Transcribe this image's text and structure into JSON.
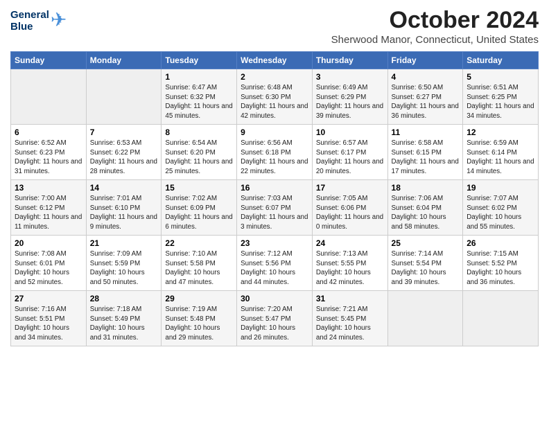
{
  "logo": {
    "line1": "General",
    "line2": "Blue"
  },
  "title": "October 2024",
  "location": "Sherwood Manor, Connecticut, United States",
  "days_of_week": [
    "Sunday",
    "Monday",
    "Tuesday",
    "Wednesday",
    "Thursday",
    "Friday",
    "Saturday"
  ],
  "weeks": [
    [
      {
        "num": "",
        "detail": ""
      },
      {
        "num": "",
        "detail": ""
      },
      {
        "num": "1",
        "detail": "Sunrise: 6:47 AM\nSunset: 6:32 PM\nDaylight: 11 hours and 45 minutes."
      },
      {
        "num": "2",
        "detail": "Sunrise: 6:48 AM\nSunset: 6:30 PM\nDaylight: 11 hours and 42 minutes."
      },
      {
        "num": "3",
        "detail": "Sunrise: 6:49 AM\nSunset: 6:29 PM\nDaylight: 11 hours and 39 minutes."
      },
      {
        "num": "4",
        "detail": "Sunrise: 6:50 AM\nSunset: 6:27 PM\nDaylight: 11 hours and 36 minutes."
      },
      {
        "num": "5",
        "detail": "Sunrise: 6:51 AM\nSunset: 6:25 PM\nDaylight: 11 hours and 34 minutes."
      }
    ],
    [
      {
        "num": "6",
        "detail": "Sunrise: 6:52 AM\nSunset: 6:23 PM\nDaylight: 11 hours and 31 minutes."
      },
      {
        "num": "7",
        "detail": "Sunrise: 6:53 AM\nSunset: 6:22 PM\nDaylight: 11 hours and 28 minutes."
      },
      {
        "num": "8",
        "detail": "Sunrise: 6:54 AM\nSunset: 6:20 PM\nDaylight: 11 hours and 25 minutes."
      },
      {
        "num": "9",
        "detail": "Sunrise: 6:56 AM\nSunset: 6:18 PM\nDaylight: 11 hours and 22 minutes."
      },
      {
        "num": "10",
        "detail": "Sunrise: 6:57 AM\nSunset: 6:17 PM\nDaylight: 11 hours and 20 minutes."
      },
      {
        "num": "11",
        "detail": "Sunrise: 6:58 AM\nSunset: 6:15 PM\nDaylight: 11 hours and 17 minutes."
      },
      {
        "num": "12",
        "detail": "Sunrise: 6:59 AM\nSunset: 6:14 PM\nDaylight: 11 hours and 14 minutes."
      }
    ],
    [
      {
        "num": "13",
        "detail": "Sunrise: 7:00 AM\nSunset: 6:12 PM\nDaylight: 11 hours and 11 minutes."
      },
      {
        "num": "14",
        "detail": "Sunrise: 7:01 AM\nSunset: 6:10 PM\nDaylight: 11 hours and 9 minutes."
      },
      {
        "num": "15",
        "detail": "Sunrise: 7:02 AM\nSunset: 6:09 PM\nDaylight: 11 hours and 6 minutes."
      },
      {
        "num": "16",
        "detail": "Sunrise: 7:03 AM\nSunset: 6:07 PM\nDaylight: 11 hours and 3 minutes."
      },
      {
        "num": "17",
        "detail": "Sunrise: 7:05 AM\nSunset: 6:06 PM\nDaylight: 11 hours and 0 minutes."
      },
      {
        "num": "18",
        "detail": "Sunrise: 7:06 AM\nSunset: 6:04 PM\nDaylight: 10 hours and 58 minutes."
      },
      {
        "num": "19",
        "detail": "Sunrise: 7:07 AM\nSunset: 6:02 PM\nDaylight: 10 hours and 55 minutes."
      }
    ],
    [
      {
        "num": "20",
        "detail": "Sunrise: 7:08 AM\nSunset: 6:01 PM\nDaylight: 10 hours and 52 minutes."
      },
      {
        "num": "21",
        "detail": "Sunrise: 7:09 AM\nSunset: 5:59 PM\nDaylight: 10 hours and 50 minutes."
      },
      {
        "num": "22",
        "detail": "Sunrise: 7:10 AM\nSunset: 5:58 PM\nDaylight: 10 hours and 47 minutes."
      },
      {
        "num": "23",
        "detail": "Sunrise: 7:12 AM\nSunset: 5:56 PM\nDaylight: 10 hours and 44 minutes."
      },
      {
        "num": "24",
        "detail": "Sunrise: 7:13 AM\nSunset: 5:55 PM\nDaylight: 10 hours and 42 minutes."
      },
      {
        "num": "25",
        "detail": "Sunrise: 7:14 AM\nSunset: 5:54 PM\nDaylight: 10 hours and 39 minutes."
      },
      {
        "num": "26",
        "detail": "Sunrise: 7:15 AM\nSunset: 5:52 PM\nDaylight: 10 hours and 36 minutes."
      }
    ],
    [
      {
        "num": "27",
        "detail": "Sunrise: 7:16 AM\nSunset: 5:51 PM\nDaylight: 10 hours and 34 minutes."
      },
      {
        "num": "28",
        "detail": "Sunrise: 7:18 AM\nSunset: 5:49 PM\nDaylight: 10 hours and 31 minutes."
      },
      {
        "num": "29",
        "detail": "Sunrise: 7:19 AM\nSunset: 5:48 PM\nDaylight: 10 hours and 29 minutes."
      },
      {
        "num": "30",
        "detail": "Sunrise: 7:20 AM\nSunset: 5:47 PM\nDaylight: 10 hours and 26 minutes."
      },
      {
        "num": "31",
        "detail": "Sunrise: 7:21 AM\nSunset: 5:45 PM\nDaylight: 10 hours and 24 minutes."
      },
      {
        "num": "",
        "detail": ""
      },
      {
        "num": "",
        "detail": ""
      }
    ]
  ]
}
